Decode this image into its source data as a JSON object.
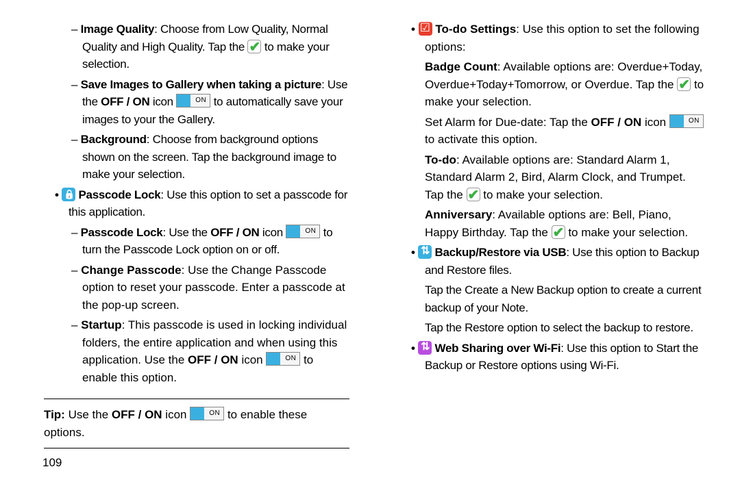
{
  "left": {
    "imgq1": "Image Quality",
    "imgq2": ":  Choose from Low Quality, Normal Quality and High Quality. Tap the ",
    "imgq3": " to make your selection.",
    "save1": "Save Images to Gallery when taking a picture",
    "save2": ": Use the ",
    "save3": "OFF / ON",
    "save4": " icon ",
    "save5": " to automatically save your images to your the Gallery.",
    "bg1": "Background",
    "bg2": ": Choose from background options shown on the screen. Tap the background image to make your selection.",
    "pl_head1": "Passcode Lock",
    "pl_head2": ": Use this option to set a passcode for this application.",
    "pl1": "Passcode Lock",
    "pl2": ": Use the ",
    "pl3": "OFF / ON",
    "pl4": " icon ",
    "pl5": " to turn the Passcode Lock option on or off.",
    "cp1": "Change Passcode",
    "cp2": ": Use the Change Passcode option to reset your passcode. Enter a passcode at the pop-up screen.",
    "st1": "Startup",
    "st2": ": This passcode is used in locking individual folders, the entire application and when using this application. Use the ",
    "st3": "OFF / ON",
    "st4": " icon ",
    "st5": " to enable this option.",
    "tip1": "Tip:",
    "tip2": " Use the ",
    "tip3": "OFF / ON",
    "tip4": " icon ",
    "tip5": " to enable these options."
  },
  "right": {
    "todo1": "To-do Settings",
    "todo2": ": Use this option to set the following options:",
    "badge1": "Badge Count",
    "badge2": ": Available options are: Overdue+Today, Overdue+Today+Tomorrow, or Overdue. Tap the ",
    "badge3": " to make your selection.",
    "alarm1": "Set Alarm for Due-date: Tap the ",
    "alarm2": "OFF / ON",
    "alarm3": " icon ",
    "alarm4": " to activate this option.",
    "td1": "To-do",
    "td2": ": Available options are: Standard Alarm 1, Standard Alarm 2, Bird, Alarm Clock, and Trumpet. Tap the ",
    "td3": " to make your selection.",
    "anv1": "Anniversary",
    "anv2": ": Available options are: Bell, Piano, Happy Birthday. Tap the ",
    "anv3": " to make your selection.",
    "br1": "Backup/Restore via USB",
    "br2": ": Use this option to Backup and Restore files.",
    "br3": "Tap the Create a New Backup option to create a current backup of your Note.",
    "br4": "Tap the Restore option to select the backup to restore.",
    "ws1": "Web Sharing over Wi-Fi",
    "ws2": ": Use this option to Start the Backup or Restore options using Wi-Fi."
  },
  "page_number": "109",
  "chart_data": null
}
